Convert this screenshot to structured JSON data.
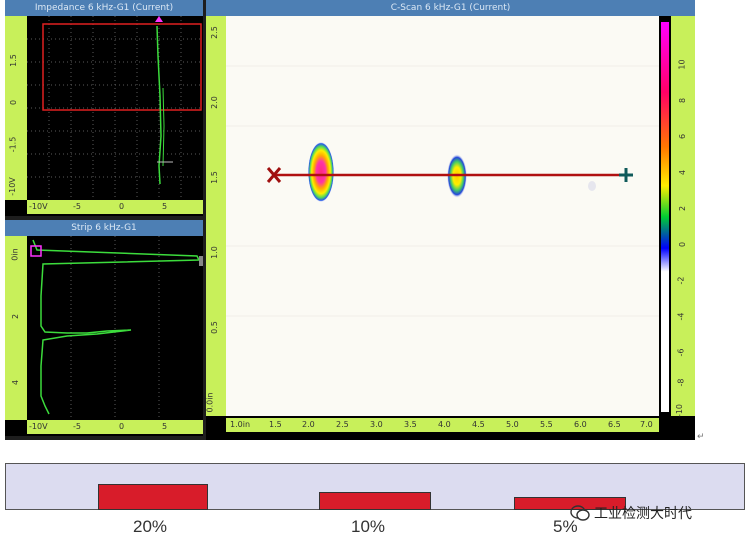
{
  "impedance": {
    "title": "Impedance 6 kHz-G1 (Current)",
    "y_ticks": [
      "1.5",
      "0",
      "-1.5",
      "-10V"
    ],
    "x_ticks": [
      "-10V",
      "-5",
      "0",
      "5"
    ]
  },
  "strip": {
    "title": "Strip 6 kHz-G1",
    "y_ticks": [
      "0in",
      "2",
      "4"
    ],
    "x_ticks": [
      "-10V",
      "-5",
      "0",
      "5"
    ]
  },
  "cscan": {
    "title": "C-Scan 6 kHz-G1 (Current)",
    "y_ticks": [
      "2.5",
      "2.0",
      "1.5",
      "1.0",
      "0.5",
      "0.0in"
    ],
    "x_ticks": [
      "1.0in",
      "1.5",
      "2.0",
      "2.5",
      "3.0",
      "3.5",
      "4.0",
      "4.5",
      "5.0",
      "5.5",
      "6.0",
      "6.5",
      "7.0"
    ],
    "scale_ticks": [
      "10",
      "8",
      "6",
      "4",
      "2",
      "0",
      "-2",
      "-4",
      "-6",
      "-8",
      "-10"
    ]
  },
  "defects": {
    "labels": [
      "20%",
      "10%",
      "5%"
    ],
    "depth_percent": [
      20,
      10,
      5
    ],
    "bar_color": "#d81c2a"
  },
  "watermark": {
    "text": "工业检测大时代"
  },
  "colors": {
    "titlebar": "#4d7fb4",
    "ruler": "#c8f05a",
    "signal": "#3cdc3c",
    "scan_line": "#b01010"
  },
  "icons": {
    "start_marker": "x-mark-icon",
    "end_marker": "crosshair-icon",
    "watermark_logo": "chat-bubble-icon"
  },
  "return_mark": "↵"
}
